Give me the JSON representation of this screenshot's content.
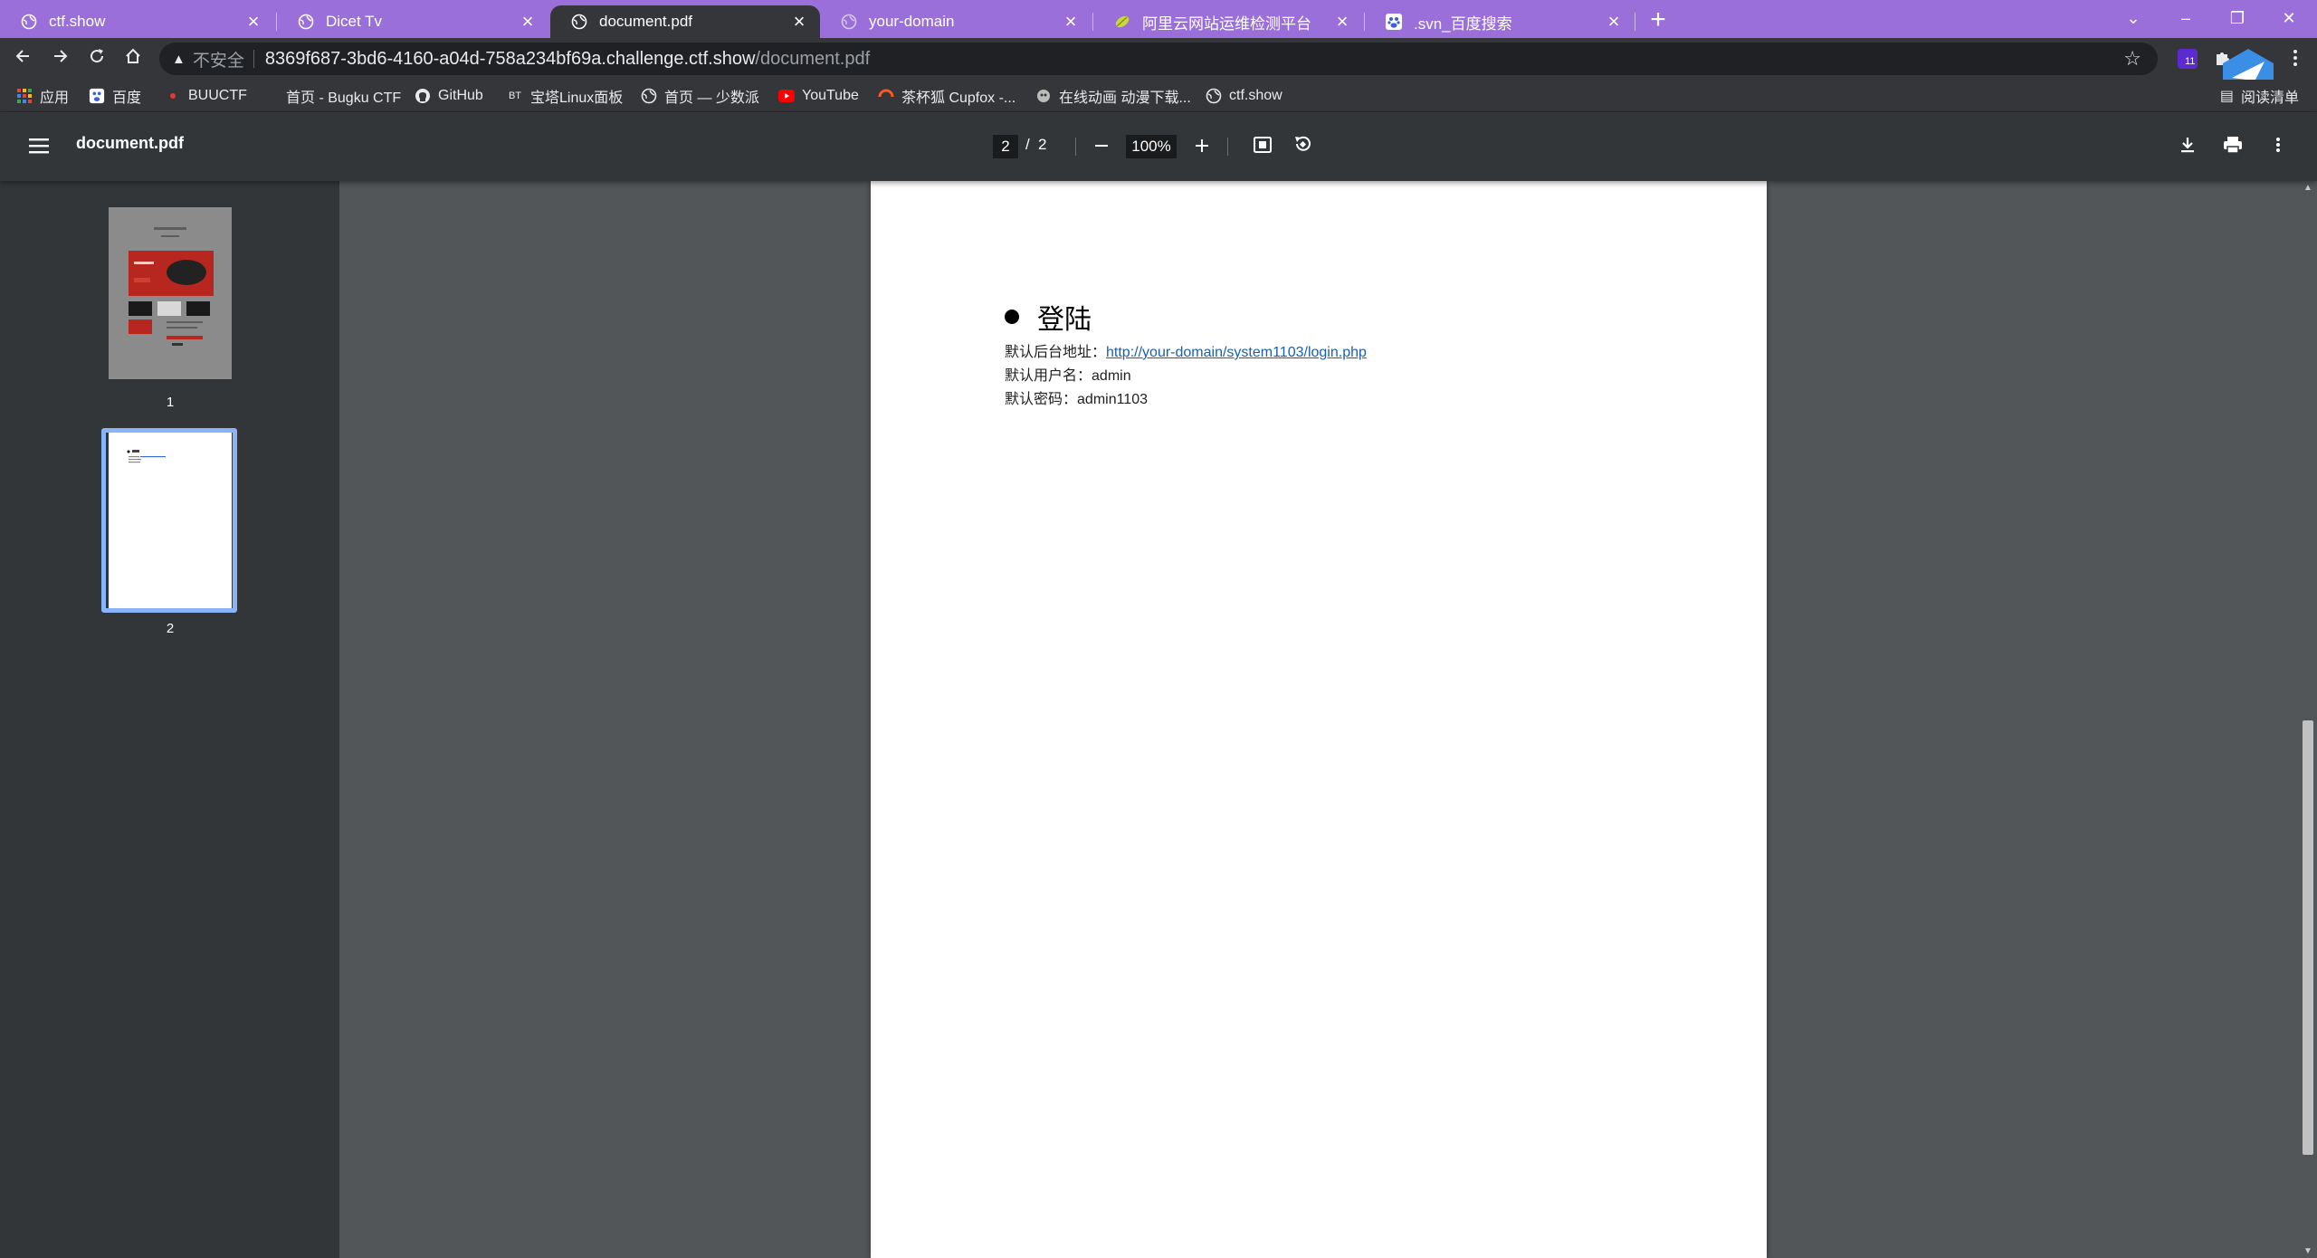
{
  "browser": {
    "tabs": [
      {
        "title": "ctf.show",
        "icon": "globe-icon"
      },
      {
        "title": "Dicet Tv",
        "icon": "globe-icon"
      },
      {
        "title": "document.pdf",
        "icon": "globe-icon",
        "active": true
      },
      {
        "title": "your-domain",
        "icon": "globe-icon"
      },
      {
        "title": "阿里云网站运维检测平台",
        "icon": "leaf-icon"
      },
      {
        "title": ".svn_百度搜索",
        "icon": "baidu-paw-icon"
      }
    ],
    "address": {
      "security_label": "不安全",
      "host": "8369f687-3bd6-4160-a04d-758a234bf69a.challenge.ctf.show",
      "path": "/document.pdf"
    },
    "extension_badge": "11",
    "bookmarks": [
      {
        "label": "应用",
        "icon": "apps-grid-icon"
      },
      {
        "label": "百度",
        "icon": "baidu-paw-icon"
      },
      {
        "label": "BUUCTF",
        "icon": "buuctf-icon"
      },
      {
        "label": "首页 - Bugku CTF",
        "icon": "bugku-icon"
      },
      {
        "label": "GitHub",
        "icon": "github-icon"
      },
      {
        "label": "宝塔Linux面板",
        "icon": "bt-icon"
      },
      {
        "label": "首页 — 少数派",
        "icon": "globe-icon"
      },
      {
        "label": "YouTube",
        "icon": "youtube-icon"
      },
      {
        "label": "茶杯狐 Cupfox -...",
        "icon": "cupfox-icon"
      },
      {
        "label": "在线动画 动漫下载...",
        "icon": "anime-icon"
      },
      {
        "label": "ctf.show",
        "icon": "globe-icon"
      }
    ],
    "reading_list_label": "阅读清单"
  },
  "pdf_viewer": {
    "title": "document.pdf",
    "current_page": "2",
    "page_separator": "/",
    "total_pages": "2",
    "zoom": "100%",
    "thumbnails": [
      {
        "label": "1"
      },
      {
        "label": "2",
        "selected": true
      }
    ]
  },
  "document": {
    "heading": "登陆",
    "lines": [
      {
        "label": "默认后台地址：",
        "value": "http://your-domain/system1103/login.php",
        "is_link": true
      },
      {
        "label": "默认用户名：",
        "value": "admin"
      },
      {
        "label": "默认密码：",
        "value": "admin1103"
      }
    ]
  },
  "colors": {
    "tabstrip": "#9b6fd9",
    "toolbar": "#35363a",
    "pdf_header": "#323639",
    "viewer_bg": "#525659",
    "link": "#1a5fb4",
    "thumb_selected": "#8ab4f8"
  }
}
